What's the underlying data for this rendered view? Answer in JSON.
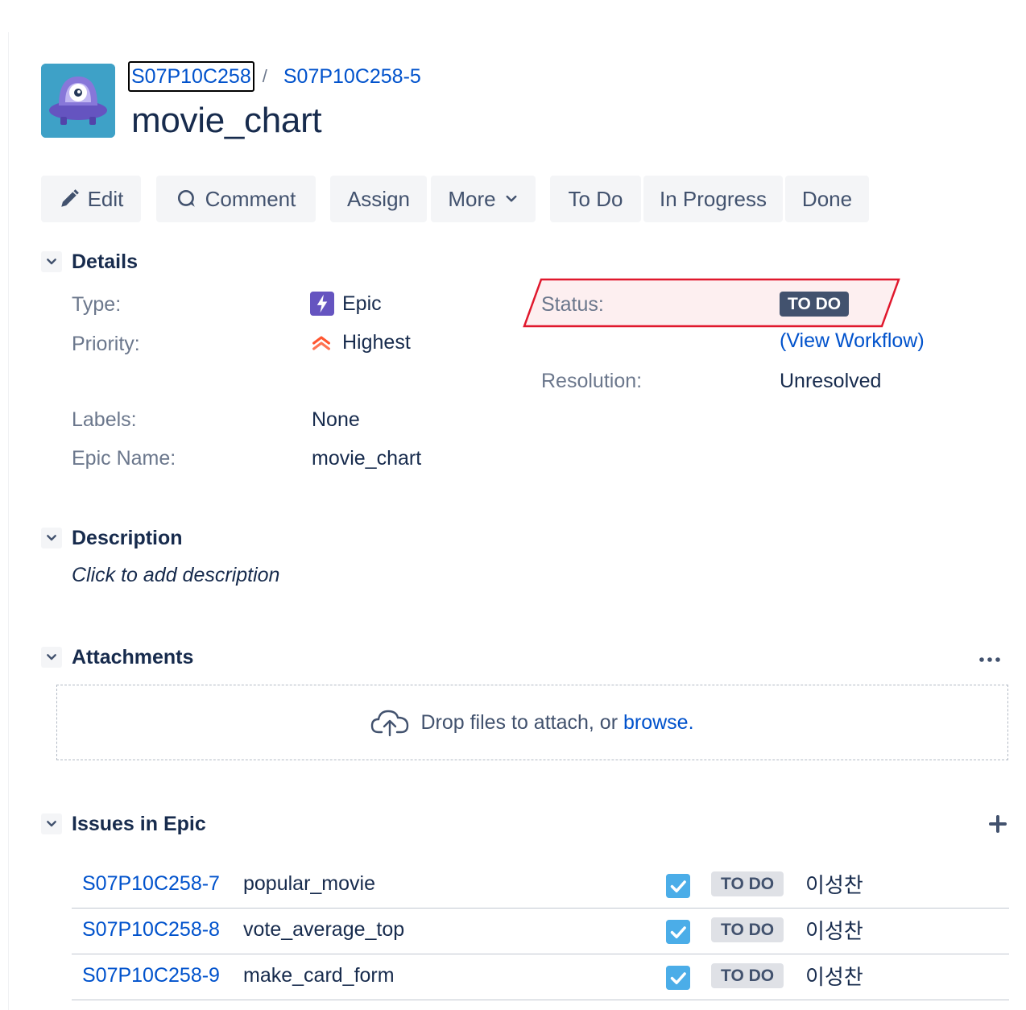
{
  "header": {
    "breadcrumb_project": "S07P10C258",
    "breadcrumb_separator": "/",
    "breadcrumb_issue": "S07P10C258-5",
    "title": "movie_chart"
  },
  "toolbar": {
    "edit": "Edit",
    "comment": "Comment",
    "assign": "Assign",
    "more": "More",
    "todo": "To Do",
    "in_progress": "In Progress",
    "done": "Done"
  },
  "details": {
    "section_title": "Details",
    "type_label": "Type:",
    "type_value": "Epic",
    "priority_label": "Priority:",
    "priority_value": "Highest",
    "status_label": "Status:",
    "status_value": "TO DO",
    "view_workflow": "(View Workflow)",
    "resolution_label": "Resolution:",
    "resolution_value": "Unresolved",
    "labels_label": "Labels:",
    "labels_value": "None",
    "epic_name_label": "Epic Name:",
    "epic_name_value": "movie_chart"
  },
  "description": {
    "section_title": "Description",
    "placeholder": "Click to add description"
  },
  "attachments": {
    "section_title": "Attachments",
    "drop_text": "Drop files to attach, or",
    "browse": "browse."
  },
  "issues": {
    "section_title": "Issues in Epic",
    "rows": [
      {
        "key": "S07P10C258-7",
        "summary": "popular_movie",
        "status": "TO DO",
        "assignee": "이성찬"
      },
      {
        "key": "S07P10C258-8",
        "summary": "vote_average_top",
        "status": "TO DO",
        "assignee": "이성찬"
      },
      {
        "key": "S07P10C258-9",
        "summary": "make_card_form",
        "status": "TO DO",
        "assignee": "이성찬"
      }
    ]
  },
  "colors": {
    "link": "#0052cc",
    "text": "#172b4d",
    "muted": "#6b778c",
    "button_bg": "#f4f5f7",
    "epic_purple": "#6554c0",
    "priority_red": "#ff5630",
    "task_blue": "#4bade8",
    "status_dark": "#42526e",
    "status_light": "#dfe1e6",
    "highlight_red": "#e0182d"
  },
  "icons": {
    "project_avatar": "ufo-robot-avatar",
    "edit": "pencil-icon",
    "comment": "speech-bubble-icon",
    "more": "chevron-down-icon",
    "section_toggle": "chevron-down-icon",
    "epic": "lightning-icon",
    "priority": "double-chevron-up-icon",
    "attachments_menu": "ellipsis-icon",
    "upload": "cloud-upload-icon",
    "add_issue": "plus-icon",
    "task": "checkbox-check-icon"
  }
}
